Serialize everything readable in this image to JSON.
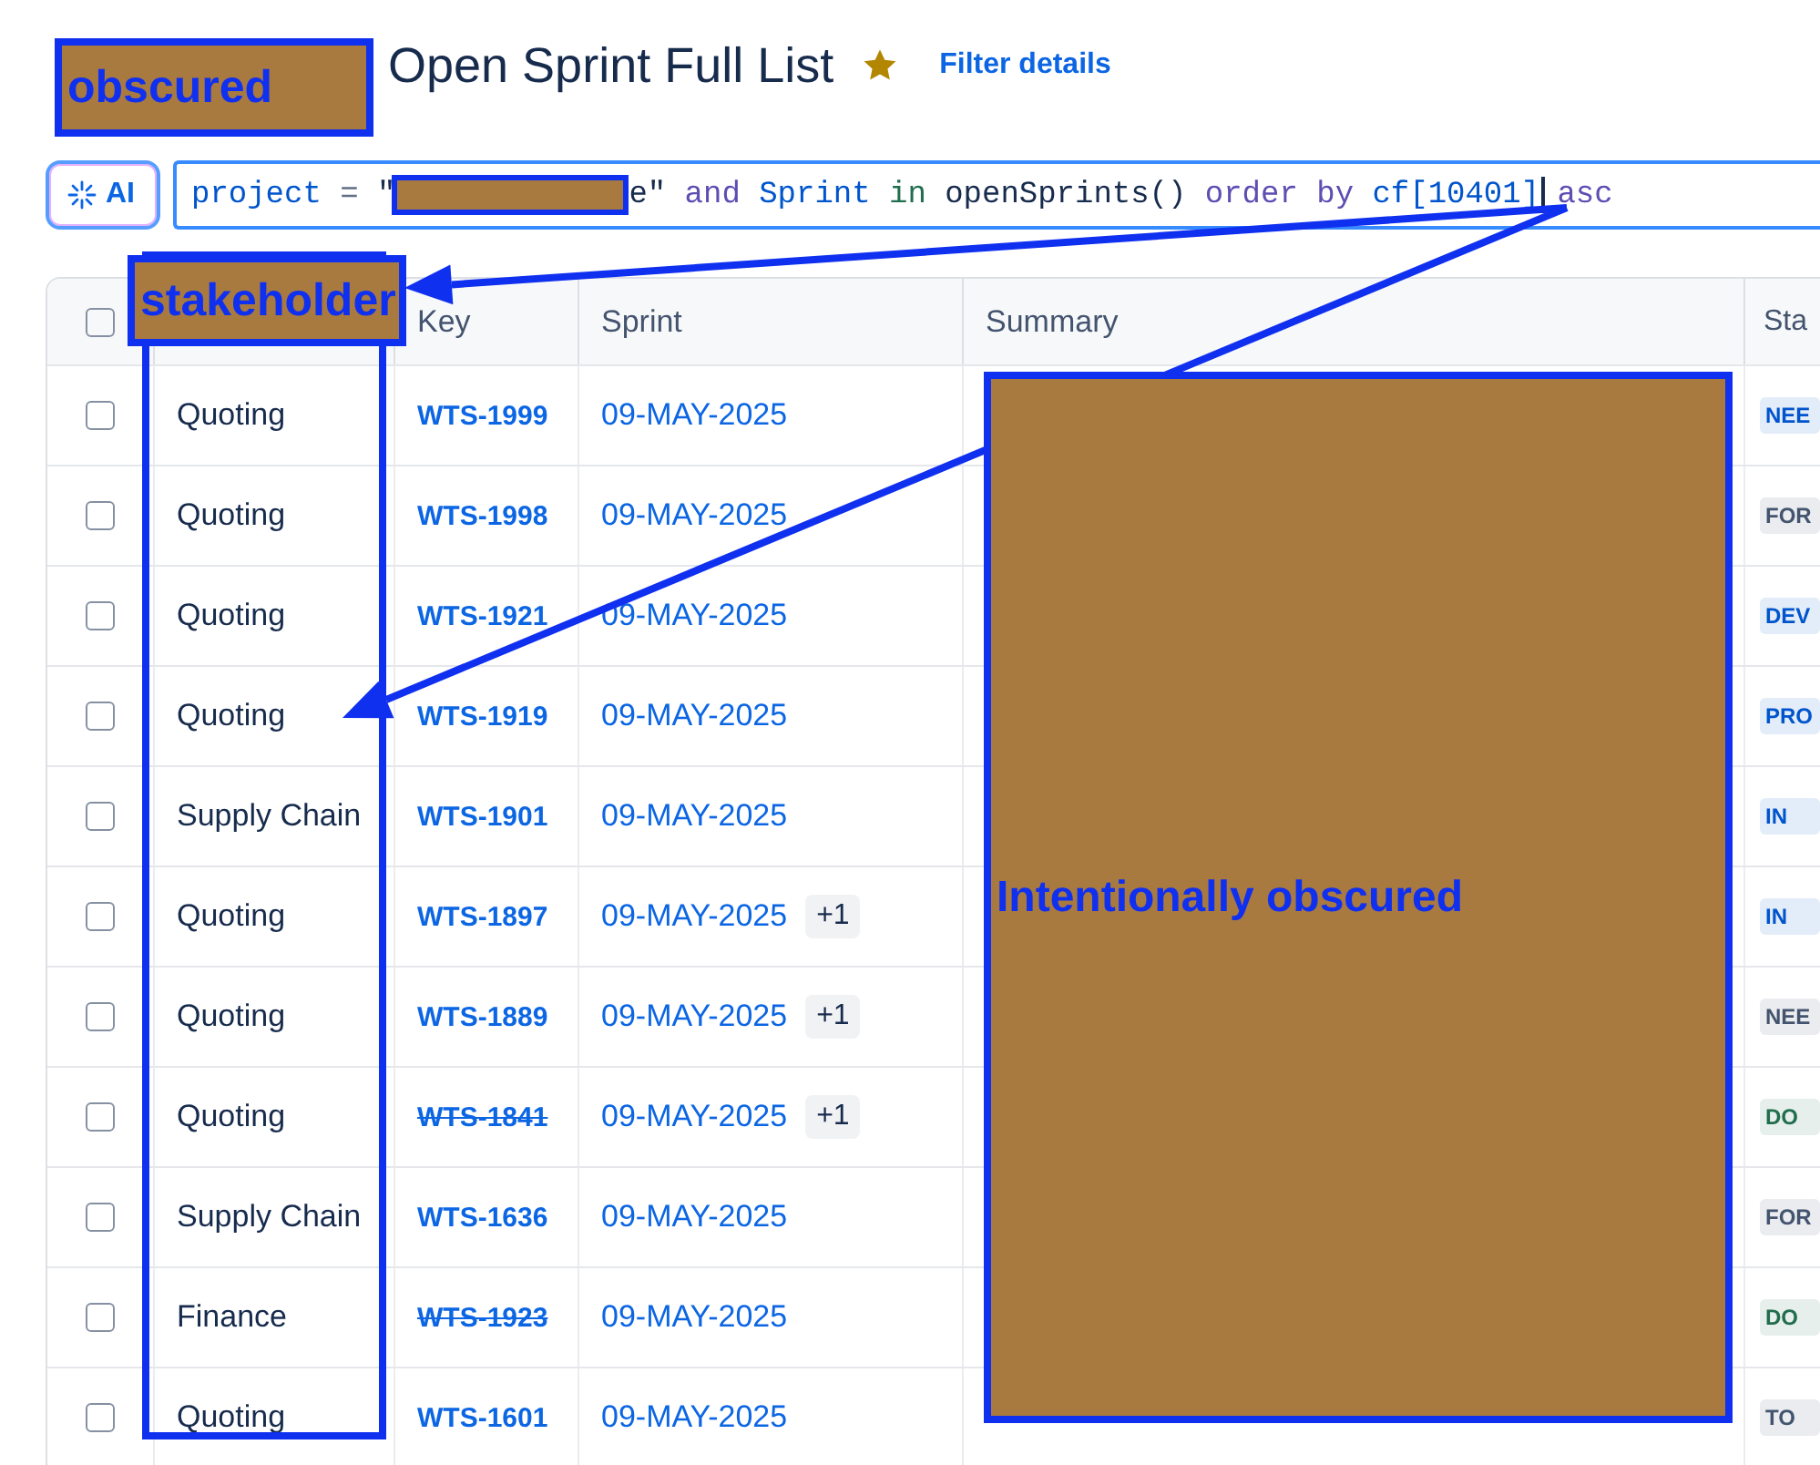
{
  "header": {
    "title": "Open Sprint Full List",
    "starred": true,
    "filter_link": "Filter details"
  },
  "title_redaction": {
    "label": "obscured"
  },
  "query": {
    "ai_button": "AI",
    "tokens": [
      {
        "text": "project",
        "kind": "field"
      },
      {
        "text": "=",
        "kind": "operator"
      },
      {
        "text": "\"",
        "kind": "string"
      },
      {
        "kind": "redaction"
      },
      {
        "text": "e\"",
        "kind": "string"
      },
      {
        "text": "and",
        "kind": "keyword"
      },
      {
        "text": "Sprint",
        "kind": "field"
      },
      {
        "text": "in",
        "kind": "operator_word"
      },
      {
        "text": "openSprints()",
        "kind": "function"
      },
      {
        "text": "order by",
        "kind": "keyword"
      },
      {
        "text": "cf[10401]",
        "kind": "field"
      },
      {
        "text": "asc",
        "kind": "keyword",
        "caret_before": true
      }
    ]
  },
  "column_header_redaction": {
    "label": "stakeholder"
  },
  "summary_redaction": {
    "label": "Intentionally obscured"
  },
  "table": {
    "select_all_checked": false,
    "columns": [
      {
        "kind": "covered"
      },
      {
        "kind": "text",
        "label": "Key"
      },
      {
        "kind": "text",
        "label": "Sprint"
      },
      {
        "kind": "text",
        "label": "Summary"
      },
      {
        "kind": "text",
        "label": "Sta"
      }
    ],
    "rows": [
      {
        "checked": false,
        "stakeholder": "Quoting",
        "key": "WTS-1999",
        "struck": false,
        "sprint": "09-MAY-2025",
        "status": "NEE",
        "color": "#0055cc"
      },
      {
        "checked": false,
        "stakeholder": "Quoting",
        "key": "WTS-1998",
        "struck": false,
        "sprint": "09-MAY-2025",
        "status": "FOR",
        "color": "#44546f"
      },
      {
        "checked": false,
        "stakeholder": "Quoting",
        "key": "WTS-1921",
        "struck": false,
        "sprint": "09-MAY-2025",
        "status": "DEV",
        "color": "#0055cc"
      },
      {
        "checked": false,
        "stakeholder": "Quoting",
        "key": "WTS-1919",
        "struck": false,
        "sprint": "09-MAY-2025",
        "status": "PRO",
        "color": "#0055cc"
      },
      {
        "checked": false,
        "stakeholder": "Supply Chain",
        "key": "WTS-1901",
        "struck": false,
        "sprint": "09-MAY-2025",
        "status": "IN",
        "color": "#0055cc"
      },
      {
        "checked": false,
        "stakeholder": "Quoting",
        "key": "WTS-1897",
        "struck": false,
        "sprint": "09-MAY-2025",
        "more": "+1",
        "status": "IN",
        "color": "#0055cc"
      },
      {
        "checked": false,
        "stakeholder": "Quoting",
        "key": "WTS-1889",
        "struck": false,
        "sprint": "09-MAY-2025",
        "more": "+1",
        "status": "NEE",
        "color": "#44546f"
      },
      {
        "checked": false,
        "stakeholder": "Quoting",
        "key": "WTS-1841",
        "struck": true,
        "sprint": "09-MAY-2025",
        "more": "+1",
        "status": "DO",
        "color": "#216e4e"
      },
      {
        "checked": false,
        "stakeholder": "Supply Chain",
        "key": "WTS-1636",
        "struck": false,
        "sprint": "09-MAY-2025",
        "status": "FOR",
        "color": "#44546f"
      },
      {
        "checked": false,
        "stakeholder": "Finance",
        "key": "WTS-1923",
        "struck": true,
        "sprint": "09-MAY-2025",
        "status": "DO",
        "color": "#216e4e"
      },
      {
        "checked": false,
        "stakeholder": "Quoting",
        "key": "WTS-1601",
        "struck": false,
        "sprint": "09-MAY-2025",
        "status": "TO",
        "color": "#44546f"
      }
    ]
  }
}
